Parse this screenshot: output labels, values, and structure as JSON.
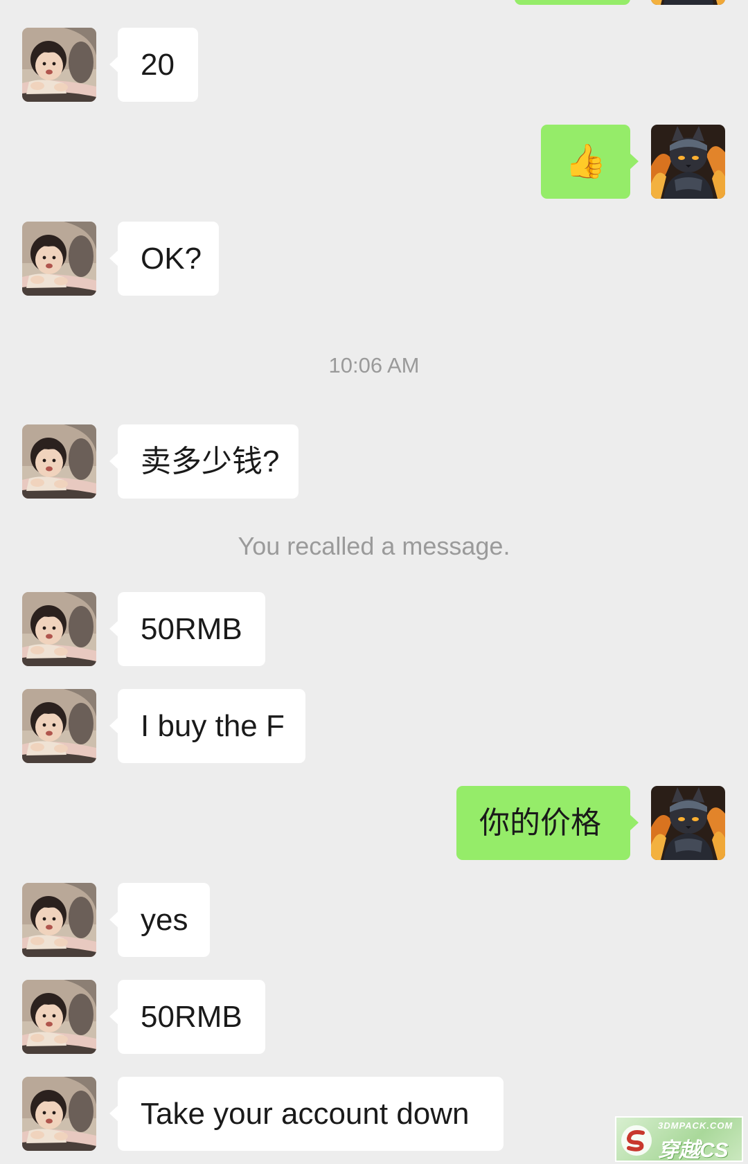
{
  "messages": [
    {
      "side": "out",
      "text": ""
    },
    {
      "side": "in",
      "text": "20"
    },
    {
      "side": "out",
      "text": "👍"
    },
    {
      "side": "in",
      "text": "OK?"
    },
    {
      "side": "in",
      "text": "卖多少钱?"
    },
    {
      "side": "in",
      "text": "50RMB"
    },
    {
      "side": "in",
      "text": "I buy the F"
    },
    {
      "side": "out",
      "text": "你的价格"
    },
    {
      "side": "in",
      "text": "yes"
    },
    {
      "side": "in",
      "text": "50RMB"
    },
    {
      "side": "in",
      "text": "Take your account down"
    }
  ],
  "system": {
    "timestamp": "10:06 AM",
    "recall_notice": "You recalled a message."
  },
  "avatars": {
    "contact": "toddler-photo-avatar",
    "self": "armored-cat-avatar"
  },
  "colors": {
    "background": "#ededed",
    "incoming_bubble": "#ffffff",
    "outgoing_bubble": "#95ec69",
    "system_text": "#9a9a9a"
  },
  "watermark": {
    "url": "3DMPACK.COM",
    "name": "穿越CS"
  }
}
